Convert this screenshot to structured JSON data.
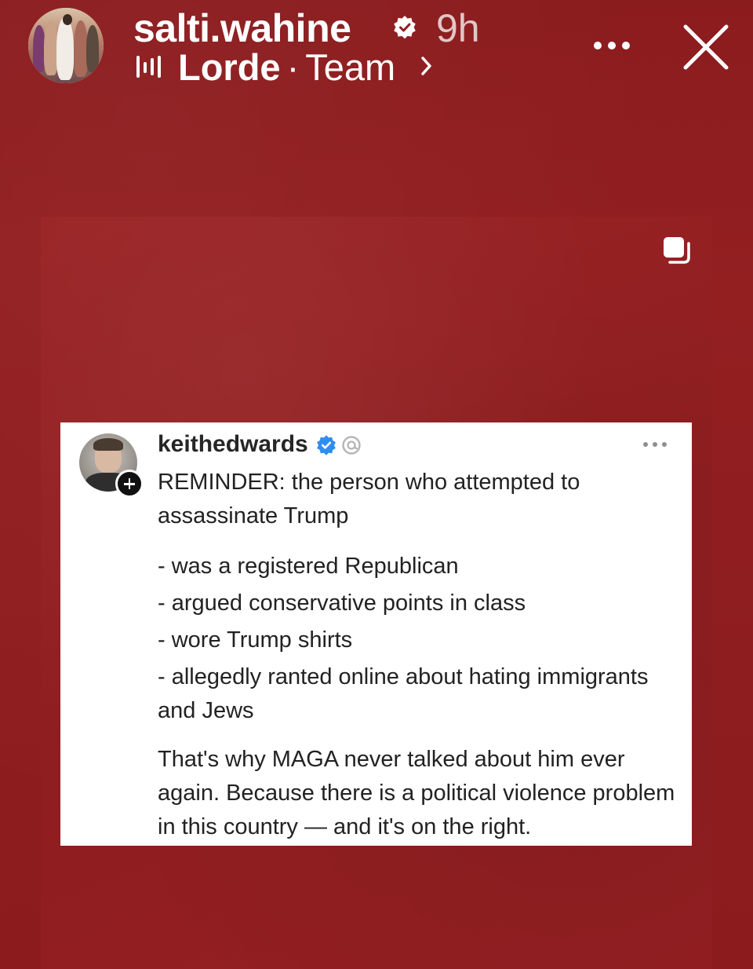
{
  "story": {
    "username": "salti.wahine",
    "time_ago": "9h",
    "music": {
      "artist": "Lorde",
      "separator": "·",
      "title": "Team"
    },
    "colors": {
      "background": "#8f1d1f",
      "text": "#ffffff"
    }
  },
  "icons": {
    "verified": "verified-badge-icon",
    "music": "audio-bars-icon",
    "chevron": "chevron-right-icon",
    "more": "more-horizontal-icon",
    "close": "close-icon",
    "multi": "carousel-multiple-icon"
  },
  "post": {
    "handle": "keithedwards",
    "verified_color": "#3897f0",
    "intro": "REMINDER: the person who attempted to assassinate Trump",
    "bullets": [
      "- was a registered Republican",
      "- argued conservative points in class",
      "- wore Trump shirts",
      "- allegedly ranted online about hating immigrants and Jews"
    ],
    "conclusion": "That's why MAGA never talked about him ever again. Because there is a political violence problem in this country — and it's on the right."
  }
}
